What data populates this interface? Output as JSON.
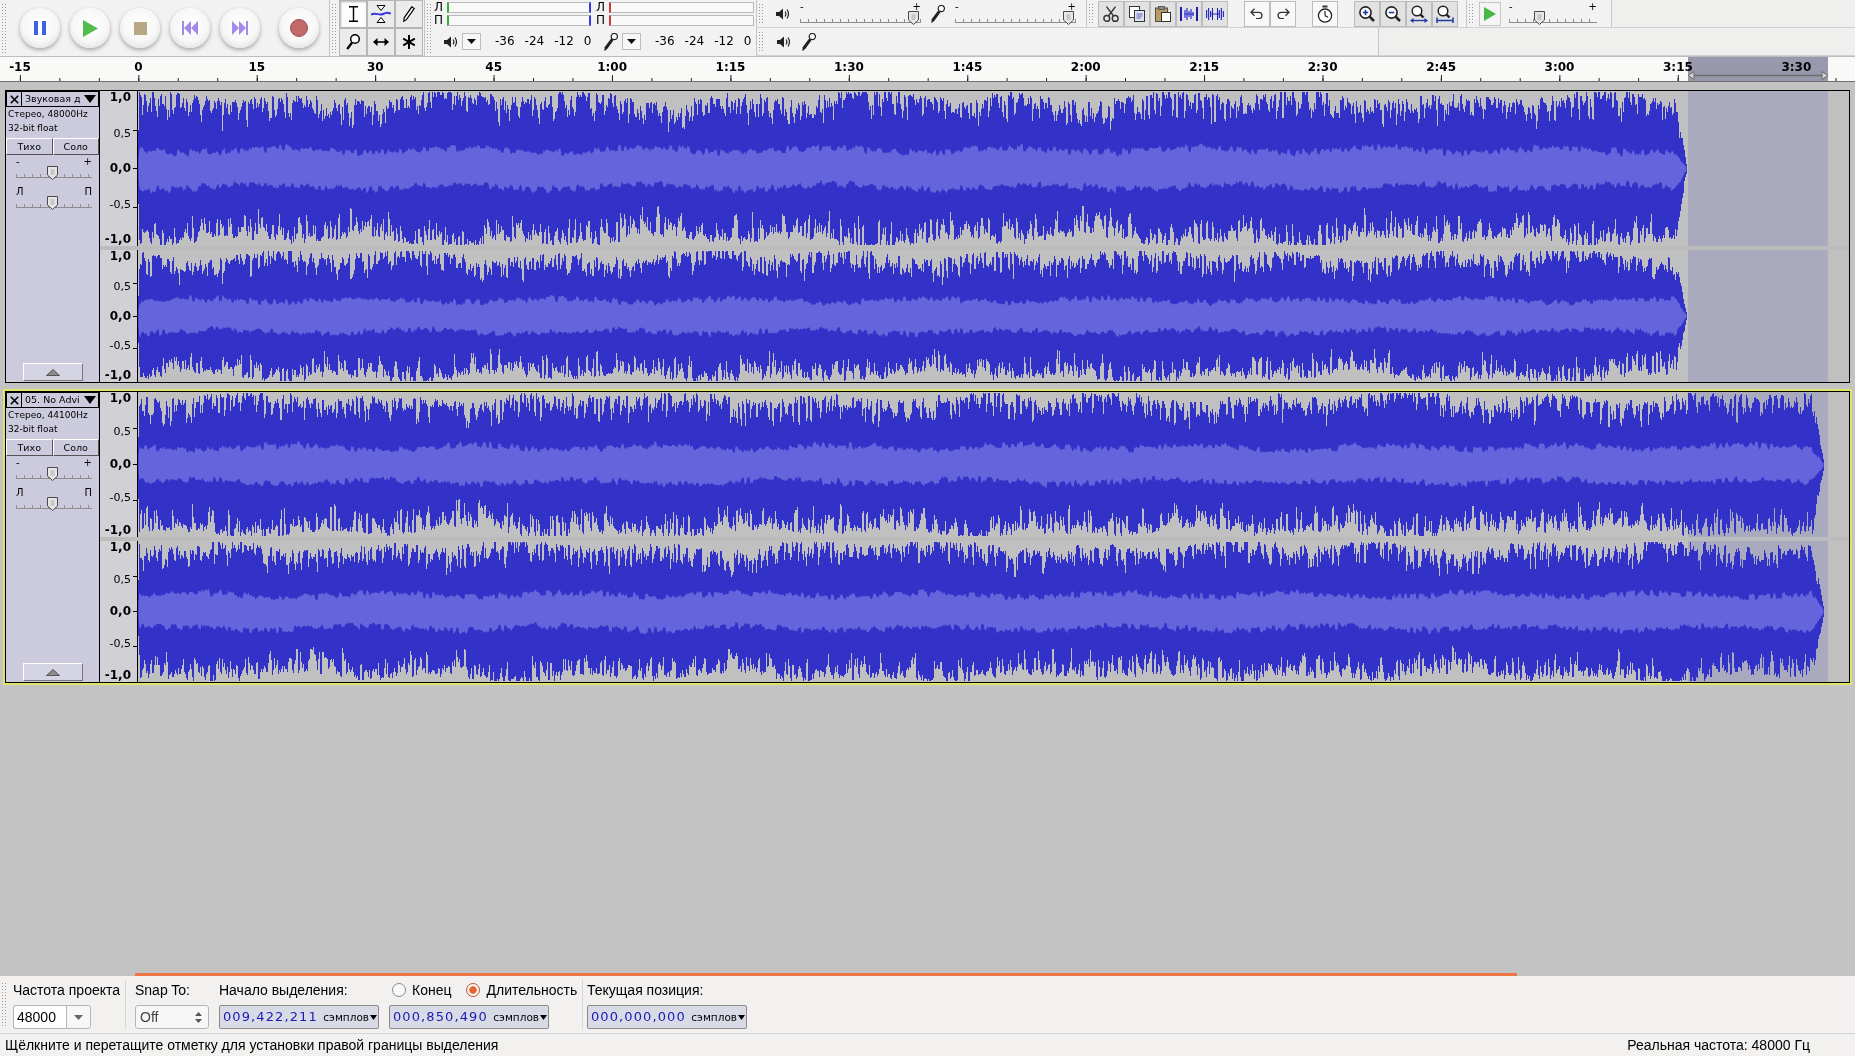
{
  "tools": [
    {
      "kind": "select",
      "selected": true
    },
    {
      "kind": "envelope",
      "selected": false
    },
    {
      "kind": "draw",
      "selected": false
    },
    {
      "kind": "zoom",
      "selected": false
    },
    {
      "kind": "timeshift",
      "selected": false
    },
    {
      "kind": "multi",
      "selected": false
    }
  ],
  "meters": [
    {
      "kind": "playback",
      "channels": [
        "Л",
        "П"
      ],
      "ticks": [
        "-36",
        "-24",
        "-12",
        "0"
      ]
    },
    {
      "kind": "recording",
      "channels": [
        "Л",
        "П"
      ],
      "ticks": [
        "-36",
        "-24",
        "-12",
        "0"
      ]
    }
  ],
  "mixer": [
    {
      "kind": "playback",
      "min_label": "-",
      "max_label": "+",
      "level": 0.98
    },
    {
      "kind": "recording",
      "min_label": "-",
      "max_label": "+",
      "level": 0.98
    }
  ],
  "play_at_speed": {
    "min_label": "-",
    "max_label": "+",
    "level": 0.32
  },
  "ruler": {
    "labels": [
      "-15",
      "0",
      "15",
      "30",
      "45",
      "1:00",
      "1:15",
      "1:30",
      "1:45",
      "2:00",
      "2:15",
      "2:30",
      "2:45",
      "3:00",
      "3:15",
      "3:30"
    ]
  },
  "tracks": [
    {
      "name": "Звуковая д",
      "info": [
        "Стерео, 48000Hz",
        "32-bit float"
      ],
      "buttons": [
        "Тихо",
        "Соло"
      ],
      "gain": {
        "min_label": "-",
        "max_label": "+",
        "level": 0.47
      },
      "pan": {
        "min_label": "Л",
        "max_label": "П",
        "level": 0.47
      },
      "focused": false,
      "channels": [
        {
          "scale": [
            "1,0",
            "0,5",
            "0,0",
            "-0,5",
            "-1,0"
          ]
        },
        {
          "scale": [
            "1,0",
            "0,5",
            "0,0",
            "-0,5",
            "-1,0"
          ]
        }
      ]
    },
    {
      "name": "05. No Advi",
      "info": [
        "Стерео, 44100Hz",
        "32-bit float"
      ],
      "buttons": [
        "Тихо",
        "Соло"
      ],
      "gain": {
        "min_label": "-",
        "max_label": "+",
        "level": 0.47
      },
      "pan": {
        "min_label": "Л",
        "max_label": "П",
        "level": 0.47
      },
      "focused": true,
      "channels": [
        {
          "scale": [
            "1,0",
            "0,5",
            "0,0",
            "-0,5",
            "-1,0"
          ]
        },
        {
          "scale": [
            "1,0",
            "0,5",
            "0,0",
            "-0,5",
            "-1,0"
          ]
        }
      ]
    }
  ],
  "selection_bar": {
    "rate": {
      "label": "Частота проекта",
      "value": "48000"
    },
    "snap": {
      "label": "Snap To:",
      "value": "Off"
    },
    "start": {
      "label": "Начало выделения:",
      "value": "009,422,211",
      "unit": "сэмплов"
    },
    "end_mode": [
      {
        "label": "Конец",
        "selected": false
      },
      {
        "label": "Длительность",
        "selected": true
      }
    ],
    "length": {
      "value": "000,850,490",
      "unit": "сэмплов"
    },
    "position": {
      "label": "Текущая позиция:",
      "value": "000,000,000",
      "unit": "сэмплов"
    }
  },
  "status_bar": {
    "message": "Щёлкните и перетащите отметку для установки правой границы выделения",
    "rate": "Реальная частота: 48000 Гц"
  }
}
